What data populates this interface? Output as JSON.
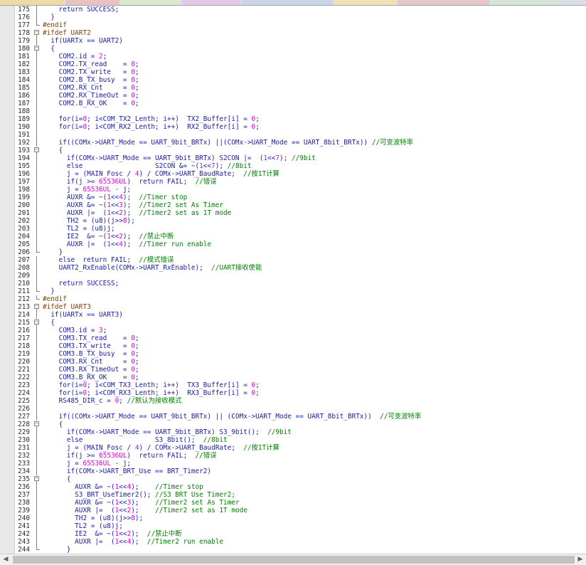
{
  "tabs": [
    {
      "color": "#f1d9a6"
    },
    {
      "color": "#e9c3c3"
    },
    {
      "color": "#d9e9c9"
    },
    {
      "color": "#e2c9e6"
    },
    {
      "color": "#c9d6ea"
    },
    {
      "color": "#f2e0b5"
    },
    {
      "color": "#e6c6c6"
    },
    {
      "color": "#d6e6d6"
    }
  ],
  "colors": {
    "keyword": "#1a1aa6",
    "number": "#e000e0",
    "comment": "#008000",
    "preprocessor": "#804000"
  },
  "lines": [
    {
      "n": "175",
      "f": "v",
      "t": [
        [
          "tx",
          "    return SUCCESS;"
        ]
      ]
    },
    {
      "n": "176",
      "f": "v",
      "t": [
        [
          "tx",
          "  }"
        ]
      ]
    },
    {
      "n": "177",
      "f": "e",
      "t": [
        [
          "pp",
          "#endif"
        ]
      ]
    },
    {
      "n": "178",
      "f": "b",
      "t": [
        [
          "pp",
          "#ifdef UART2"
        ]
      ]
    },
    {
      "n": "179",
      "f": "v",
      "t": [
        [
          "tx",
          "  if(UARTx == UART2)"
        ]
      ]
    },
    {
      "n": "180",
      "f": "b",
      "t": [
        [
          "tx",
          "  {"
        ]
      ]
    },
    {
      "n": "181",
      "f": "v",
      "t": [
        [
          "tx",
          "    COM2.id = "
        ],
        [
          "num",
          "2"
        ],
        [
          "tx",
          ";"
        ]
      ]
    },
    {
      "n": "182",
      "f": "v",
      "t": [
        [
          "tx",
          "    COM2.TX_read    = "
        ],
        [
          "num",
          "0"
        ],
        [
          "tx",
          ";"
        ]
      ]
    },
    {
      "n": "183",
      "f": "v",
      "t": [
        [
          "tx",
          "    COM2.TX_write   = "
        ],
        [
          "num",
          "0"
        ],
        [
          "tx",
          ";"
        ]
      ]
    },
    {
      "n": "184",
      "f": "v",
      "t": [
        [
          "tx",
          "    COM2.B_TX_busy  = "
        ],
        [
          "num",
          "0"
        ],
        [
          "tx",
          ";"
        ]
      ]
    },
    {
      "n": "185",
      "f": "v",
      "t": [
        [
          "tx",
          "    COM2.RX_Cnt     = "
        ],
        [
          "num",
          "0"
        ],
        [
          "tx",
          ";"
        ]
      ]
    },
    {
      "n": "186",
      "f": "v",
      "t": [
        [
          "tx",
          "    COM2.RX_TimeOut = "
        ],
        [
          "num",
          "0"
        ],
        [
          "tx",
          ";"
        ]
      ]
    },
    {
      "n": "187",
      "f": "v",
      "t": [
        [
          "tx",
          "    COM2.B_RX_OK    = "
        ],
        [
          "num",
          "0"
        ],
        [
          "tx",
          ";"
        ]
      ]
    },
    {
      "n": "188",
      "f": "v",
      "t": [
        [
          "tx",
          ""
        ]
      ]
    },
    {
      "n": "189",
      "f": "v",
      "t": [
        [
          "tx",
          "    for(i="
        ],
        [
          "num",
          "0"
        ],
        [
          "tx",
          "; i<COM_TX2_Lenth; i++)  TX2_Buffer[i] = "
        ],
        [
          "num",
          "0"
        ],
        [
          "tx",
          ";"
        ]
      ]
    },
    {
      "n": "190",
      "f": "v",
      "t": [
        [
          "tx",
          "    for(i="
        ],
        [
          "num",
          "0"
        ],
        [
          "tx",
          "; i<COM_RX2_Lenth; i++)  RX2_Buffer[i] = "
        ],
        [
          "num",
          "0"
        ],
        [
          "tx",
          ";"
        ]
      ]
    },
    {
      "n": "191",
      "f": "v",
      "t": [
        [
          "tx",
          ""
        ]
      ]
    },
    {
      "n": "192",
      "f": "v",
      "t": [
        [
          "tx",
          "    if((COMx->UART_Mode == UART_9bit_BRTx) ||(COMx->UART_Mode == UART_8bit_BRTx)) "
        ],
        [
          "cm",
          "//可变波特率"
        ]
      ]
    },
    {
      "n": "193",
      "f": "b",
      "t": [
        [
          "tx",
          "    {"
        ]
      ]
    },
    {
      "n": "194",
      "f": "v",
      "t": [
        [
          "tx",
          "      if(COMx->UART_Mode == UART_9bit_BRTx) S2CON |=  ("
        ],
        [
          "num",
          "1"
        ],
        [
          "tx",
          "<<"
        ],
        [
          "num",
          "7"
        ],
        [
          "tx",
          "); "
        ],
        [
          "cm",
          "//9bit"
        ]
      ]
    },
    {
      "n": "195",
      "f": "v",
      "t": [
        [
          "tx",
          "      else                  S2CON &= ~("
        ],
        [
          "num",
          "1"
        ],
        [
          "tx",
          "<<"
        ],
        [
          "num",
          "7"
        ],
        [
          "tx",
          "); "
        ],
        [
          "cm",
          "//8bit"
        ]
      ]
    },
    {
      "n": "196",
      "f": "v",
      "t": [
        [
          "tx",
          "      j = (MAIN_Fosc / "
        ],
        [
          "num",
          "4"
        ],
        [
          "tx",
          ") / COMx->UART_BaudRate;  "
        ],
        [
          "cm",
          "//按1T计算"
        ]
      ]
    },
    {
      "n": "197",
      "f": "v",
      "t": [
        [
          "tx",
          "      if(j >= "
        ],
        [
          "num",
          "65536UL"
        ],
        [
          "tx",
          ")  return FAIL;  "
        ],
        [
          "cm",
          "//错误"
        ]
      ]
    },
    {
      "n": "198",
      "f": "v",
      "t": [
        [
          "tx",
          "      j = "
        ],
        [
          "num",
          "65536UL"
        ],
        [
          "tx",
          " - j;"
        ]
      ]
    },
    {
      "n": "199",
      "f": "v",
      "t": [
        [
          "tx",
          "      AUXR &= ~("
        ],
        [
          "num",
          "1"
        ],
        [
          "tx",
          "<<"
        ],
        [
          "num",
          "4"
        ],
        [
          "tx",
          ");  "
        ],
        [
          "cm",
          "//Timer stop"
        ]
      ]
    },
    {
      "n": "200",
      "f": "v",
      "t": [
        [
          "tx",
          "      AUXR &= ~("
        ],
        [
          "num",
          "1"
        ],
        [
          "tx",
          "<<"
        ],
        [
          "num",
          "3"
        ],
        [
          "tx",
          ");  "
        ],
        [
          "cm",
          "//Timer2 set As Timer"
        ]
      ]
    },
    {
      "n": "201",
      "f": "v",
      "t": [
        [
          "tx",
          "      AUXR |=  ("
        ],
        [
          "num",
          "1"
        ],
        [
          "tx",
          "<<"
        ],
        [
          "num",
          "2"
        ],
        [
          "tx",
          ");  "
        ],
        [
          "cm",
          "//Timer2 set as 1T mode"
        ]
      ]
    },
    {
      "n": "202",
      "f": "v",
      "t": [
        [
          "tx",
          "      TH2 = (u8)(j>>"
        ],
        [
          "num",
          "8"
        ],
        [
          "tx",
          ");"
        ]
      ]
    },
    {
      "n": "203",
      "f": "v",
      "t": [
        [
          "tx",
          "      TL2 = (u8)j;"
        ]
      ]
    },
    {
      "n": "204",
      "f": "v",
      "t": [
        [
          "tx",
          "      IE2  &= ~("
        ],
        [
          "num",
          "1"
        ],
        [
          "tx",
          "<<"
        ],
        [
          "num",
          "2"
        ],
        [
          "tx",
          ");  "
        ],
        [
          "cm",
          "//禁止中断"
        ]
      ]
    },
    {
      "n": "205",
      "f": "v",
      "t": [
        [
          "tx",
          "      AUXR |=  ("
        ],
        [
          "num",
          "1"
        ],
        [
          "tx",
          "<<"
        ],
        [
          "num",
          "4"
        ],
        [
          "tx",
          ");  "
        ],
        [
          "cm",
          "//Timer run enable"
        ]
      ]
    },
    {
      "n": "206",
      "f": "e",
      "t": [
        [
          "tx",
          "    }"
        ]
      ]
    },
    {
      "n": "207",
      "f": "v",
      "t": [
        [
          "tx",
          "    else  return FAIL;  "
        ],
        [
          "cm",
          "//模式错误"
        ]
      ]
    },
    {
      "n": "208",
      "f": "v",
      "t": [
        [
          "tx",
          "    UART2_RxEnable(COMx->UART_RxEnable);  "
        ],
        [
          "cm",
          "//UART接收使能"
        ]
      ]
    },
    {
      "n": "209",
      "f": "v",
      "t": [
        [
          "tx",
          ""
        ]
      ]
    },
    {
      "n": "210",
      "f": "v",
      "t": [
        [
          "tx",
          "    return SUCCESS;"
        ]
      ]
    },
    {
      "n": "211",
      "f": "e",
      "t": [
        [
          "tx",
          "  }"
        ]
      ]
    },
    {
      "n": "212",
      "f": "e",
      "t": [
        [
          "pp",
          "#endif"
        ]
      ]
    },
    {
      "n": "213",
      "f": "b",
      "t": [
        [
          "pp",
          "#ifdef UART3"
        ]
      ]
    },
    {
      "n": "214",
      "f": "v",
      "t": [
        [
          "tx",
          "  if(UARTx == UART3)"
        ]
      ]
    },
    {
      "n": "215",
      "f": "b",
      "t": [
        [
          "tx",
          "  {"
        ]
      ]
    },
    {
      "n": "216",
      "f": "v",
      "t": [
        [
          "tx",
          "    COM3.id = "
        ],
        [
          "num",
          "3"
        ],
        [
          "tx",
          ";"
        ]
      ]
    },
    {
      "n": "217",
      "f": "v",
      "t": [
        [
          "tx",
          "    COM3.TX_read    = "
        ],
        [
          "num",
          "0"
        ],
        [
          "tx",
          ";"
        ]
      ]
    },
    {
      "n": "218",
      "f": "v",
      "t": [
        [
          "tx",
          "    COM3.TX_write   = "
        ],
        [
          "num",
          "0"
        ],
        [
          "tx",
          ";"
        ]
      ]
    },
    {
      "n": "219",
      "f": "v",
      "t": [
        [
          "tx",
          "    COM3.B_TX_busy  = "
        ],
        [
          "num",
          "0"
        ],
        [
          "tx",
          ";"
        ]
      ]
    },
    {
      "n": "220",
      "f": "v",
      "t": [
        [
          "tx",
          "    COM3.RX_Cnt     = "
        ],
        [
          "num",
          "0"
        ],
        [
          "tx",
          ";"
        ]
      ]
    },
    {
      "n": "221",
      "f": "v",
      "t": [
        [
          "tx",
          "    COM3.RX_TimeOut = "
        ],
        [
          "num",
          "0"
        ],
        [
          "tx",
          ";"
        ]
      ]
    },
    {
      "n": "222",
      "f": "v",
      "t": [
        [
          "tx",
          "    COM3.B_RX_OK    = "
        ],
        [
          "num",
          "0"
        ],
        [
          "tx",
          ";"
        ]
      ]
    },
    {
      "n": "223",
      "f": "v",
      "t": [
        [
          "tx",
          "    for(i="
        ],
        [
          "num",
          "0"
        ],
        [
          "tx",
          "; i<COM_TX3_Lenth; i++)  TX3_Buffer[i] = "
        ],
        [
          "num",
          "0"
        ],
        [
          "tx",
          ";"
        ]
      ]
    },
    {
      "n": "224",
      "f": "v",
      "t": [
        [
          "tx",
          "    for(i="
        ],
        [
          "num",
          "0"
        ],
        [
          "tx",
          "; i<COM_RX3_Lenth; i++)  RX3_Buffer[i] = "
        ],
        [
          "num",
          "0"
        ],
        [
          "tx",
          ";"
        ]
      ]
    },
    {
      "n": "225",
      "f": "v",
      "t": [
        [
          "tx",
          "    RS485_DIR_c = "
        ],
        [
          "num",
          "0"
        ],
        [
          "tx",
          "; "
        ],
        [
          "cm",
          "//默认为接收模式"
        ]
      ]
    },
    {
      "n": "226",
      "f": "v",
      "t": [
        [
          "tx",
          ""
        ]
      ]
    },
    {
      "n": "227",
      "f": "v",
      "t": [
        [
          "tx",
          "    if((COMx->UART_Mode == UART_9bit_BRTx) || (COMx->UART_Mode == UART_8bit_BRTx))  "
        ],
        [
          "cm",
          "//可变波特率"
        ]
      ]
    },
    {
      "n": "228",
      "f": "b",
      "t": [
        [
          "tx",
          "    {"
        ]
      ]
    },
    {
      "n": "229",
      "f": "v",
      "t": [
        [
          "tx",
          "      if(COMx->UART_Mode == UART_9bit_BRTx) S3_9bit();  "
        ],
        [
          "cm",
          "//9bit"
        ]
      ]
    },
    {
      "n": "230",
      "f": "v",
      "t": [
        [
          "tx",
          "      else                  S3_8bit();  "
        ],
        [
          "cm",
          "//8bit"
        ]
      ]
    },
    {
      "n": "231",
      "f": "v",
      "t": [
        [
          "tx",
          "      j = (MAIN_Fosc / "
        ],
        [
          "num",
          "4"
        ],
        [
          "tx",
          ") / COMx->UART_BaudRate;  "
        ],
        [
          "cm",
          "//按1T计算"
        ]
      ]
    },
    {
      "n": "232",
      "f": "v",
      "t": [
        [
          "tx",
          "      if(j >= "
        ],
        [
          "num",
          "65536UL"
        ],
        [
          "tx",
          ")  return FAIL;  "
        ],
        [
          "cm",
          "//错误"
        ]
      ]
    },
    {
      "n": "233",
      "f": "v",
      "t": [
        [
          "tx",
          "      j = "
        ],
        [
          "num",
          "65536UL"
        ],
        [
          "tx",
          " - j;"
        ]
      ]
    },
    {
      "n": "234",
      "f": "v",
      "t": [
        [
          "tx",
          "      if(COMx->UART_BRT_Use == BRT_Timer2)"
        ]
      ]
    },
    {
      "n": "235",
      "f": "b",
      "t": [
        [
          "tx",
          "      {"
        ]
      ]
    },
    {
      "n": "236",
      "f": "v",
      "t": [
        [
          "tx",
          "        AUXR &= ~("
        ],
        [
          "num",
          "1"
        ],
        [
          "tx",
          "<<"
        ],
        [
          "num",
          "4"
        ],
        [
          "tx",
          ");    "
        ],
        [
          "cm",
          "//Timer stop"
        ]
      ]
    },
    {
      "n": "237",
      "f": "v",
      "t": [
        [
          "tx",
          "        S3_BRT_UseTimer2(); "
        ],
        [
          "cm",
          "//S3 BRT Use Timer2;"
        ]
      ]
    },
    {
      "n": "238",
      "f": "v",
      "t": [
        [
          "tx",
          "        AUXR &= ~("
        ],
        [
          "num",
          "1"
        ],
        [
          "tx",
          "<<"
        ],
        [
          "num",
          "3"
        ],
        [
          "tx",
          ");    "
        ],
        [
          "cm",
          "//Timer2 set As Timer"
        ]
      ]
    },
    {
      "n": "239",
      "f": "v",
      "t": [
        [
          "tx",
          "        AUXR |=  ("
        ],
        [
          "num",
          "1"
        ],
        [
          "tx",
          "<<"
        ],
        [
          "num",
          "2"
        ],
        [
          "tx",
          ");    "
        ],
        [
          "cm",
          "//Timer2 set as 1T mode"
        ]
      ]
    },
    {
      "n": "240",
      "f": "v",
      "t": [
        [
          "tx",
          "        TH2 = (u8)(j>>"
        ],
        [
          "num",
          "8"
        ],
        [
          "tx",
          ");"
        ]
      ]
    },
    {
      "n": "241",
      "f": "v",
      "t": [
        [
          "tx",
          "        TL2 = (u8)j;"
        ]
      ]
    },
    {
      "n": "242",
      "f": "v",
      "t": [
        [
          "tx",
          "        IE2  &= ~("
        ],
        [
          "num",
          "1"
        ],
        [
          "tx",
          "<<"
        ],
        [
          "num",
          "2"
        ],
        [
          "tx",
          ");  "
        ],
        [
          "cm",
          "//禁止中断"
        ]
      ]
    },
    {
      "n": "243",
      "f": "v",
      "t": [
        [
          "tx",
          "        AUXR |=  ("
        ],
        [
          "num",
          "1"
        ],
        [
          "tx",
          "<<"
        ],
        [
          "num",
          "4"
        ],
        [
          "tx",
          ");  "
        ],
        [
          "cm",
          "//Timer2 run enable"
        ]
      ]
    },
    {
      "n": "244",
      "f": "e",
      "t": [
        [
          "tx",
          "      }"
        ]
      ]
    }
  ]
}
